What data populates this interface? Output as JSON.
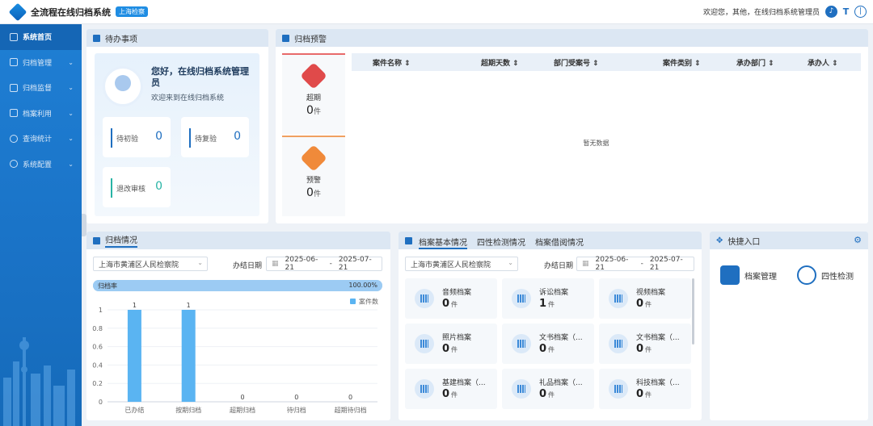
{
  "app": {
    "title": "全流程在线归档系统",
    "badge": "上海检察",
    "welcome": "欢迎您，其他，在线归档系统管理员"
  },
  "topbar_icons": [
    "bell-icon",
    "font-size-icon",
    "power-icon"
  ],
  "sidebar": {
    "items": [
      {
        "label": "系统首页",
        "icon": "home-icon",
        "active": true
      },
      {
        "label": "归档管理",
        "icon": "archive-icon"
      },
      {
        "label": "归档监督",
        "icon": "monitor-icon"
      },
      {
        "label": "档案利用",
        "icon": "document-icon"
      },
      {
        "label": "查询统计",
        "icon": "stats-icon"
      },
      {
        "label": "系统配置",
        "icon": "gear-icon"
      }
    ]
  },
  "todo": {
    "title": "待办事项",
    "greeting": "您好，在线归档系统管理员",
    "sub": "欢迎来到在线归档系统",
    "items": [
      {
        "label": "待初验",
        "value": "0"
      },
      {
        "label": "待复验",
        "value": "0"
      },
      {
        "label": "退改审核",
        "value": "0"
      }
    ]
  },
  "warning": {
    "title": "归档预警",
    "cards": [
      {
        "label": "超期",
        "value": "0",
        "unit": "件",
        "color": "#e04a4a"
      },
      {
        "label": "预警",
        "value": "0",
        "unit": "件",
        "color": "#f08a3a"
      }
    ],
    "columns": [
      "案件名称",
      "超期天数",
      "部门受案号",
      "案件类别",
      "承办部门",
      "承办人"
    ],
    "empty": "暂无数据"
  },
  "archive_status": {
    "title": "归档情况",
    "org": "上海市黄浦区人民检察院",
    "date_label": "办结日期",
    "date_from": "2025-06-21",
    "date_sep": "-",
    "date_to": "2025-07-21",
    "rate_label": "归档率",
    "rate_value": "100.00%",
    "rate_fraction": 1.0,
    "legend": "案件数"
  },
  "chart_data": {
    "type": "bar",
    "categories": [
      "已办结",
      "按期归档",
      "超期归档",
      "待归档",
      "超期待归档"
    ],
    "series": [
      {
        "name": "案件数",
        "values": [
          1,
          1,
          0,
          0,
          0
        ]
      }
    ],
    "ylim": [
      0,
      1
    ],
    "yticks": [
      "0",
      "0.2",
      "0.4",
      "0.6",
      "0.8",
      "1"
    ],
    "data_labels": [
      "1",
      "1",
      "0",
      "0",
      "0"
    ],
    "color": "#5ab4f2",
    "legend_position": "top-right"
  },
  "basics": {
    "tabs": [
      "档案基本情况",
      "四性检测情况",
      "档案借阅情况"
    ],
    "org": "上海市黄浦区人民检察院",
    "date_label": "办结日期",
    "date_from": "2025-06-21",
    "date_sep": "-",
    "date_to": "2025-07-21",
    "tiles": [
      {
        "name": "音频档案",
        "value": "0",
        "unit": "件"
      },
      {
        "name": "诉讼档案",
        "value": "1",
        "unit": "件"
      },
      {
        "name": "视频档案",
        "value": "0",
        "unit": "件"
      },
      {
        "name": "照片档案",
        "value": "0",
        "unit": "件"
      },
      {
        "name": "文书档案（...",
        "value": "0",
        "unit": "件"
      },
      {
        "name": "文书档案（...",
        "value": "0",
        "unit": "件"
      },
      {
        "name": "基建档案（...",
        "value": "0",
        "unit": "件"
      },
      {
        "name": "礼品档案（...",
        "value": "0",
        "unit": "件"
      },
      {
        "name": "科技档案（...",
        "value": "0",
        "unit": "件"
      }
    ]
  },
  "quick": {
    "title": "快捷入口",
    "items": [
      {
        "label": "档案管理",
        "icon": "archive-manage-icon"
      },
      {
        "label": "四性检测",
        "icon": "four-check-icon"
      }
    ]
  }
}
